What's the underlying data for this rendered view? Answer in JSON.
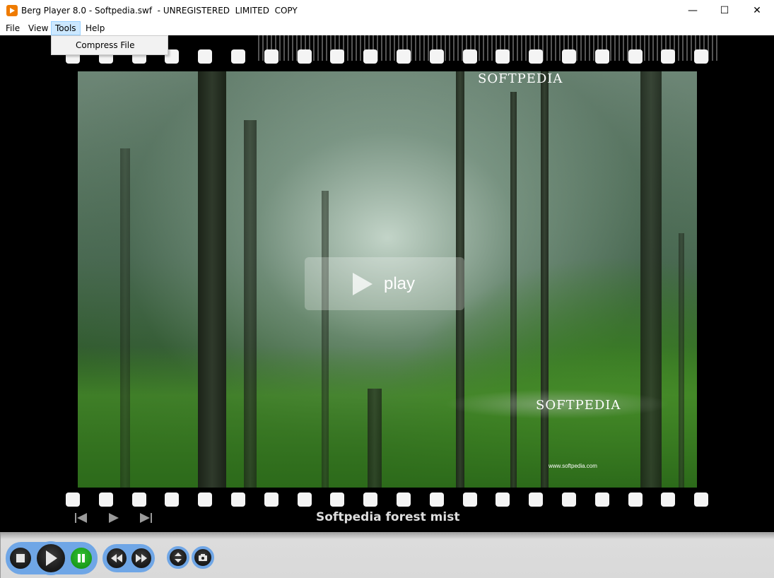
{
  "window": {
    "title": "Berg Player 8.0 - Softpedia.swf  - UNREGISTERED  LIMITED  COPY",
    "minimize_glyph": "—",
    "maximize_glyph": "☐",
    "close_glyph": "✕"
  },
  "menu": {
    "items": [
      "File",
      "View",
      "Tools",
      "Help"
    ],
    "active": "Tools",
    "dropdown": {
      "items": [
        "Compress File"
      ]
    }
  },
  "slideshow": {
    "watermark_top": "SOFTPEDIA",
    "watermark_bottom": "SOFTPEDIA",
    "watermark_url": "www.softpedia.com",
    "play_label": "play",
    "caption": "Softpedia forest mist"
  },
  "controls": {
    "transport": [
      "stop-icon",
      "play-icon",
      "pause-icon"
    ],
    "seek": [
      "rewind-icon",
      "fast-forward-icon"
    ],
    "extras": [
      "fit-size-icon",
      "snapshot-icon"
    ]
  },
  "colors": {
    "accent_ring": "#6fa6e6",
    "pause_green": "#22aa22",
    "menu_highlight": "#cce8ff"
  }
}
